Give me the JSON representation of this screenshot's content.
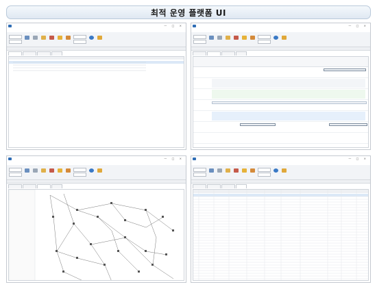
{
  "title": "최적 운영 플랫폼 UI",
  "app_window": {
    "controls": "— □ ×"
  },
  "ribbon": {
    "sections": [
      "",
      "",
      "",
      "",
      "",
      ""
    ]
  },
  "panels": [
    {
      "id": "schedule-list",
      "tabs": [
        "",
        "",
        "",
        ""
      ]
    },
    {
      "id": "gantt-view",
      "tabs": [
        "",
        "",
        "",
        ""
      ]
    },
    {
      "id": "network-map",
      "tabs": [
        "",
        "",
        "",
        ""
      ]
    },
    {
      "id": "detail-table",
      "tabs": [
        "",
        "",
        "",
        ""
      ]
    }
  ],
  "colors": {
    "title_bg": "#dfe8f2",
    "accent_blue": "#2f6db5",
    "selection": "#dbe8f7",
    "gantt_green": "#eef8ee",
    "gantt_blue": "#e6f0fb"
  }
}
